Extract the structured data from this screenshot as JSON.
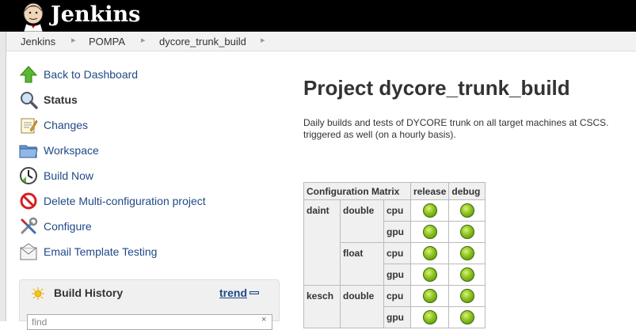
{
  "app": {
    "title": "Jenkins"
  },
  "breadcrumbs": [
    "Jenkins",
    "POMPA",
    "dycore_trunk_build"
  ],
  "breadcrumb_separator": "▸",
  "tasks": [
    {
      "label": "Back to Dashboard",
      "icon": "up-arrow-icon"
    },
    {
      "label": "Status",
      "icon": "magnifier-icon",
      "selected": true
    },
    {
      "label": "Changes",
      "icon": "notepad-icon"
    },
    {
      "label": "Workspace",
      "icon": "folder-icon"
    },
    {
      "label": "Build Now",
      "icon": "clock-icon"
    },
    {
      "label": "Delete Multi-configuration project",
      "icon": "no-entry-icon"
    },
    {
      "label": "Configure",
      "icon": "wrench-screwdriver-icon"
    },
    {
      "label": "Email Template Testing",
      "icon": "envelope-icon"
    }
  ],
  "build_history": {
    "title": "Build History",
    "trend_label": "trend",
    "search_placeholder": "find",
    "clear_glyph": "×"
  },
  "main": {
    "title": "Project dycore_trunk_build",
    "description": "Daily builds and tests of DYCORE trunk on all target machines at CSCS. triggered as well (on a hourly basis)."
  },
  "matrix": {
    "header_label": "Configuration Matrix",
    "columns": [
      "release",
      "debug"
    ],
    "status_color": "#8dc21f",
    "rows": [
      {
        "machine": "daint",
        "precision": "double",
        "target": "cpu"
      },
      {
        "machine": "daint",
        "precision": "double",
        "target": "gpu"
      },
      {
        "machine": "daint",
        "precision": "float",
        "target": "cpu"
      },
      {
        "machine": "daint",
        "precision": "float",
        "target": "gpu"
      },
      {
        "machine": "kesch",
        "precision": "double",
        "target": "cpu"
      },
      {
        "machine": "kesch",
        "precision": "double",
        "target": "gpu"
      }
    ]
  }
}
